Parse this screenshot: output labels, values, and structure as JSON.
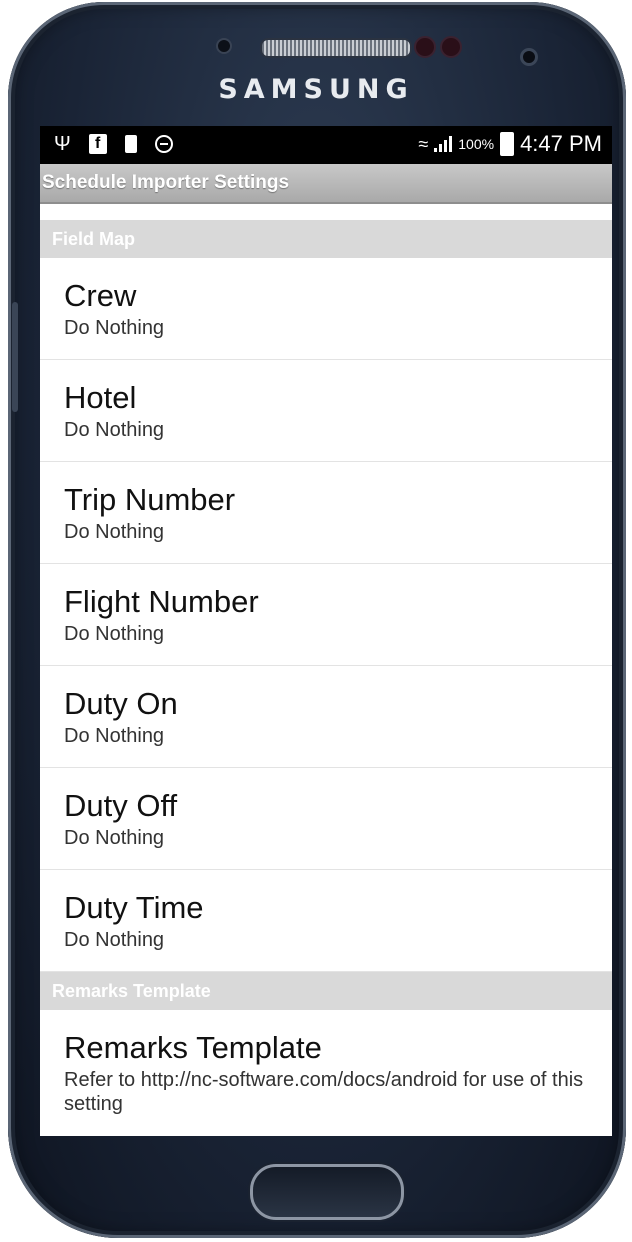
{
  "device": {
    "brand": "SAMSUNG"
  },
  "status_bar": {
    "battery_percent": "100%",
    "time": "4:47 PM",
    "icons_left": [
      "usb-icon",
      "facebook-icon",
      "battery-saver-icon",
      "do-not-disturb-icon"
    ],
    "icons_right": [
      "wifi-icon",
      "signal-icon",
      "battery-icon"
    ]
  },
  "app_bar": {
    "title": "Schedule Importer Settings"
  },
  "categories": [
    {
      "title": "Field Map",
      "items": [
        {
          "title": "Crew",
          "summary": "Do Nothing"
        },
        {
          "title": "Hotel",
          "summary": "Do Nothing"
        },
        {
          "title": "Trip Number",
          "summary": "Do Nothing"
        },
        {
          "title": "Flight Number",
          "summary": "Do Nothing"
        },
        {
          "title": "Duty On",
          "summary": "Do Nothing"
        },
        {
          "title": "Duty Off",
          "summary": "Do Nothing"
        },
        {
          "title": "Duty Time",
          "summary": "Do Nothing"
        }
      ]
    },
    {
      "title": "Remarks Template",
      "items": [
        {
          "title": "Remarks Template",
          "summary": "Refer to http://nc-software.com/docs/android for use of this setting"
        }
      ]
    }
  ]
}
